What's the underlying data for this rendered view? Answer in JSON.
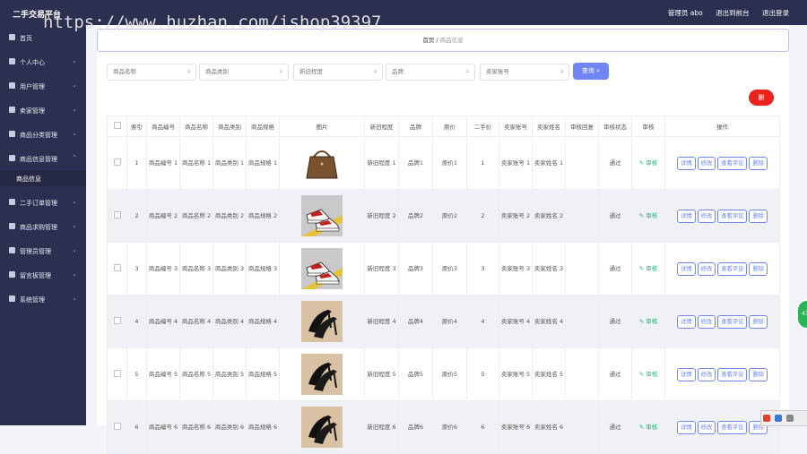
{
  "header": {
    "brand": "二手交易平台",
    "user": "管理员 abo",
    "back_front": "退出到前台",
    "logout": "退出登录"
  },
  "watermark": "https://www.huzhan.com/ishop39397",
  "sidebar": {
    "items": [
      {
        "label": "首页",
        "icon": "home-icon"
      },
      {
        "label": "个人中心",
        "icon": "user-icon"
      },
      {
        "label": "用户管理",
        "icon": "users-icon"
      },
      {
        "label": "卖家管理",
        "icon": "seller-icon"
      },
      {
        "label": "商品分类管理",
        "icon": "category-icon"
      },
      {
        "label": "商品信息管理",
        "icon": "goods-icon"
      },
      {
        "label": "二手订单管理",
        "icon": "order-icon"
      },
      {
        "label": "商品求购管理",
        "icon": "purchase-icon"
      },
      {
        "label": "管理员管理",
        "icon": "admin-icon"
      },
      {
        "label": "留言板管理",
        "icon": "message-icon"
      },
      {
        "label": "系统管理",
        "icon": "system-icon"
      }
    ],
    "submenu_label": "商品信息"
  },
  "breadcrumb": {
    "home": "首页",
    "separator": "/",
    "current": "商品信息"
  },
  "search": {
    "p_bianhao": "商品名称",
    "p_leibie": "商品类别",
    "p_xinjiu": "新旧程度",
    "p_pinpai": "品牌",
    "p_zhanghao": "卖家账号",
    "query_label": "查询"
  },
  "delete_label": "删",
  "table": {
    "headers": [
      "",
      "索引",
      "商品编号",
      "商品名称",
      "商品类别",
      "商品规格",
      "图片",
      "新旧程度",
      "品牌",
      "原价",
      "二手价",
      "卖家账号",
      "卖家姓名",
      "审核回复",
      "审核状态",
      "审核",
      "操作"
    ],
    "rows": [
      {
        "idx": "1",
        "bianhao": "商品编号 1",
        "mingcheng": "商品名称 1",
        "leibie": "商品类别 1",
        "guige": "商品规格 1",
        "image": "handbag",
        "xinjiu": "新旧程度 1",
        "pinpai": "品牌1",
        "yuanjia": "原价1",
        "ershoujia": "1",
        "zhanghao": "卖家账号 1",
        "xingming": "卖家姓名 1",
        "huifu": "",
        "zhuangtai": "通过",
        "audit": "审核"
      },
      {
        "idx": "2",
        "bianhao": "商品编号 2",
        "mingcheng": "商品名称 2",
        "leibie": "商品类别 2",
        "guige": "商品规格 2",
        "image": "sneakers",
        "xinjiu": "新旧程度 2",
        "pinpai": "品牌2",
        "yuanjia": "原价2",
        "ershoujia": "2",
        "zhanghao": "卖家账号 2",
        "xingming": "卖家姓名 2",
        "huifu": "",
        "zhuangtai": "通过",
        "audit": "审核"
      },
      {
        "idx": "3",
        "bianhao": "商品编号 3",
        "mingcheng": "商品名称 3",
        "leibie": "商品类别 3",
        "guige": "商品规格 3",
        "image": "sneakers",
        "xinjiu": "新旧程度 3",
        "pinpai": "品牌3",
        "yuanjia": "原价3",
        "ershoujia": "3",
        "zhanghao": "卖家账号 3",
        "xingming": "卖家姓名 3",
        "huifu": "",
        "zhuangtai": "通过",
        "audit": "审核"
      },
      {
        "idx": "4",
        "bianhao": "商品编号 4",
        "mingcheng": "商品名称 4",
        "leibie": "商品类别 4",
        "guige": "商品规格 4",
        "image": "heels",
        "xinjiu": "新旧程度 4",
        "pinpai": "品牌4",
        "yuanjia": "原价4",
        "ershoujia": "4",
        "zhanghao": "卖家账号 4",
        "xingming": "卖家姓名 4",
        "huifu": "",
        "zhuangtai": "通过",
        "audit": "审核"
      },
      {
        "idx": "5",
        "bianhao": "商品编号 5",
        "mingcheng": "商品名称 5",
        "leibie": "商品类别 5",
        "guige": "商品规格 5",
        "image": "heels",
        "xinjiu": "新旧程度 5",
        "pinpai": "品牌5",
        "yuanjia": "原价5",
        "ershoujia": "5",
        "zhanghao": "卖家账号 5",
        "xingming": "卖家姓名 5",
        "huifu": "",
        "zhuangtai": "通过",
        "audit": "审核"
      },
      {
        "idx": "6",
        "bianhao": "商品编号 6",
        "mingcheng": "商品名称 6",
        "leibie": "商品类别 6",
        "guige": "商品规格 6",
        "image": "heels",
        "xinjiu": "新旧程度 6",
        "pinpai": "品牌6",
        "yuanjia": "原价6",
        "ershoujia": "6",
        "zhanghao": "卖家账号 6",
        "xingming": "卖家姓名 6",
        "huifu": "",
        "zhuangtai": "通过",
        "audit": "审核"
      }
    ],
    "op_labels": {
      "detail": "详情",
      "edit": "修改",
      "comment": "查看评论",
      "delete": "删除"
    }
  },
  "colors": {
    "sidebar_bg": "#2c3050",
    "accent": "#6f86f2",
    "danger": "#e8241c",
    "success": "#1fb574"
  },
  "badge": "43"
}
